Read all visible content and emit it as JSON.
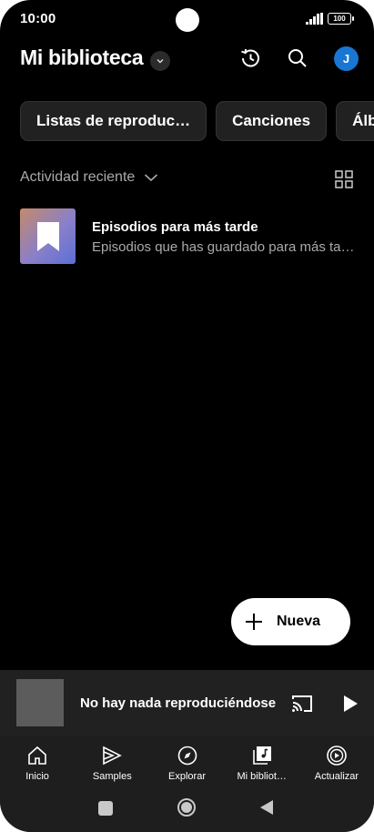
{
  "status_bar": {
    "time": "10:00",
    "battery": "100"
  },
  "header": {
    "title": "Mi biblioteca",
    "avatar_letter": "J",
    "icons": [
      "history-icon",
      "search-icon"
    ]
  },
  "chips": [
    "Listas de reproduc…",
    "Canciones",
    "Álbumes"
  ],
  "recent": {
    "label": "Actividad reciente",
    "items": [
      {
        "title": "Episodios para más tarde",
        "subtitle": "Episodios que has guardado para más tarde"
      }
    ]
  },
  "fab": {
    "label": "Nueva"
  },
  "player": {
    "text": "No hay nada reproduciéndose"
  },
  "nav": [
    {
      "label": "Inicio",
      "icon": "home-icon"
    },
    {
      "label": "Samples",
      "icon": "samples-icon"
    },
    {
      "label": "Explorar",
      "icon": "compass-icon"
    },
    {
      "label": "Mi bibliot…",
      "icon": "library-icon"
    },
    {
      "label": "Actualizar",
      "icon": "upgrade-icon"
    }
  ],
  "colors": {
    "background": "#000000",
    "avatar": "#1976d2",
    "surface": "#212121"
  }
}
